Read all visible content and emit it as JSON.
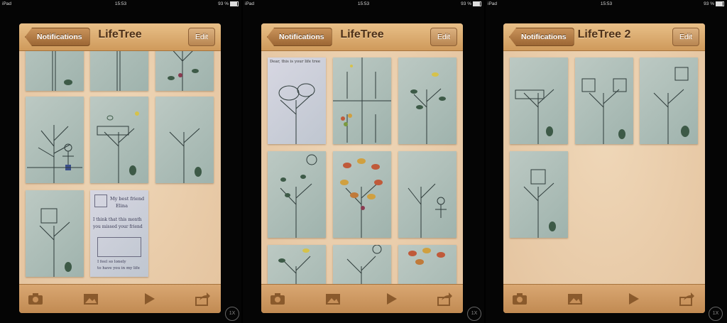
{
  "statusbar": {
    "device": "iPad",
    "time": "15:53",
    "battery": "93 %"
  },
  "screens": [
    {
      "back_label": "Notifications",
      "title": "LifeTree",
      "edit_label": "Edit"
    },
    {
      "back_label": "Notifications",
      "title": "LifeTree",
      "edit_label": "Edit"
    },
    {
      "back_label": "Notifications",
      "title": "LifeTree 2",
      "edit_label": "Edit"
    }
  ],
  "note_thumb": {
    "line1": "My best friend",
    "line2": "Elina",
    "line3": "I think that this month",
    "line4": "you missed your friend",
    "line5": "I feel so lonely",
    "line6": "to have you in my life"
  },
  "screen2_caption": "Dear, this is your life tree",
  "zoom_label": "1X",
  "icons": [
    "camera-icon",
    "photo-icon",
    "play-icon",
    "share-icon"
  ],
  "colors": {
    "navbar": "#cf9a5b",
    "background": "#e9cfaf",
    "title": "#4d3018"
  }
}
